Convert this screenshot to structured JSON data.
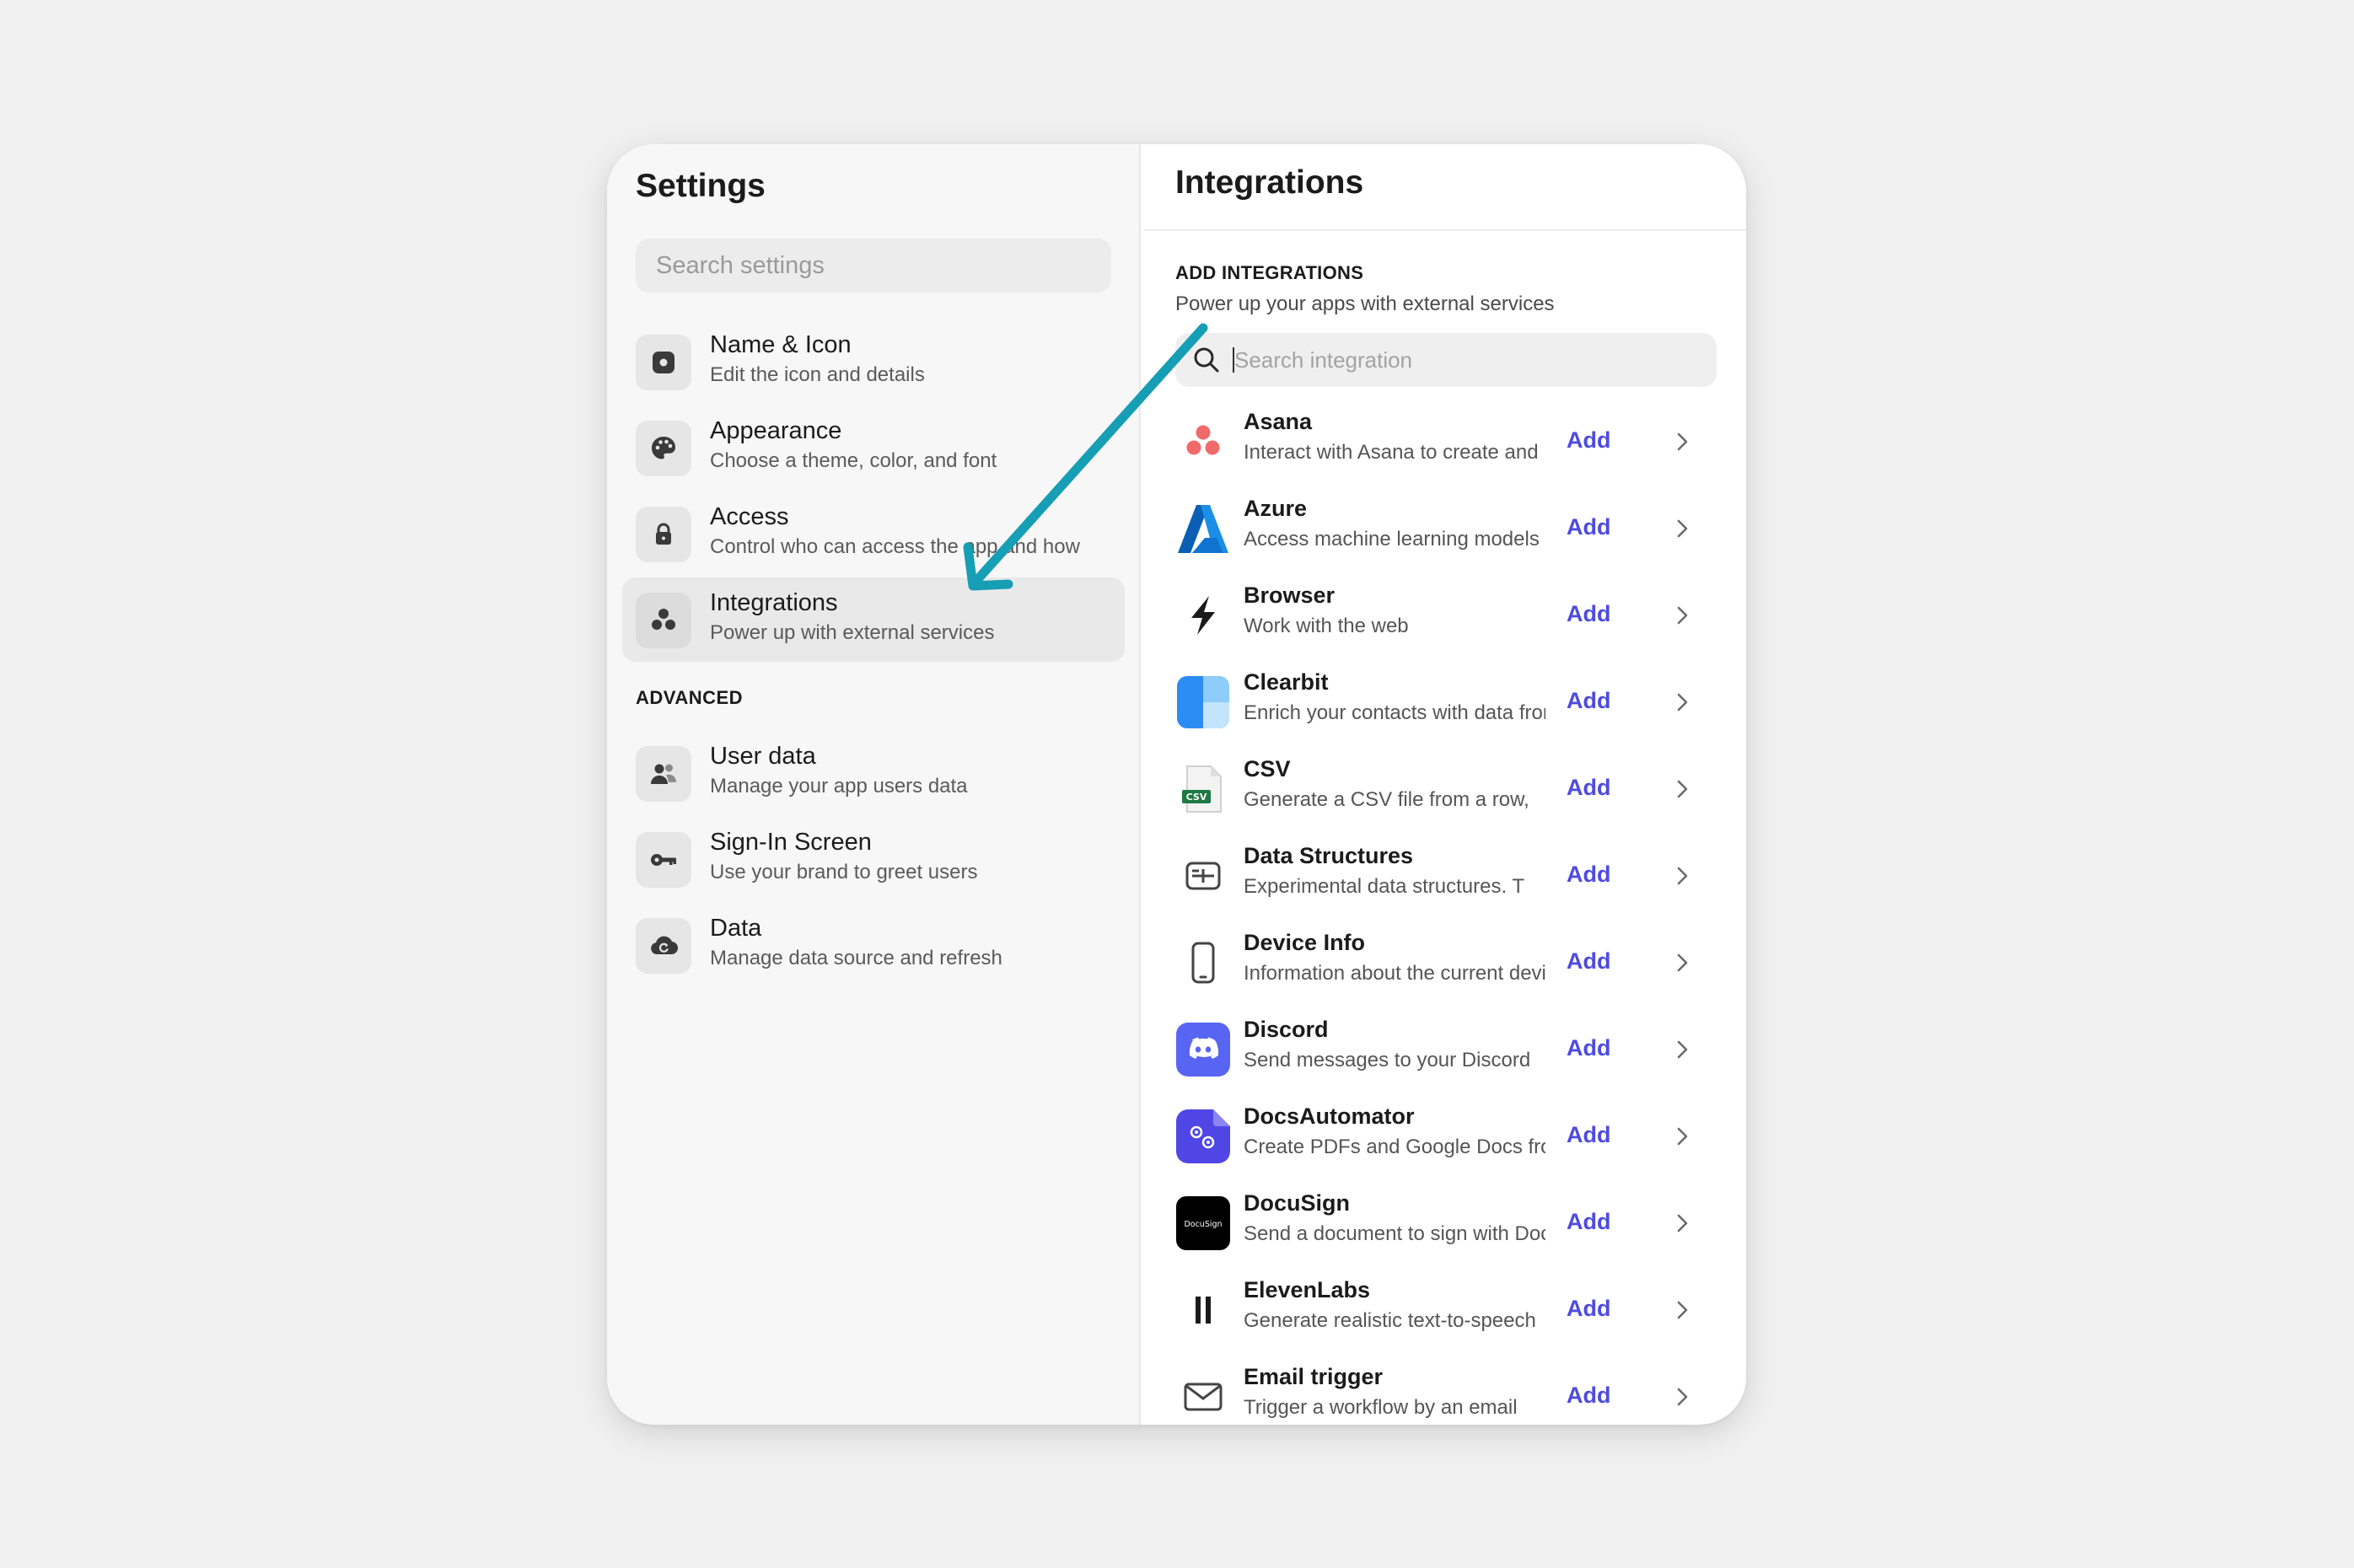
{
  "sidebar": {
    "title": "Settings",
    "search_placeholder": "Search settings",
    "items": [
      {
        "label": "Name & Icon",
        "desc": "Edit the icon and details",
        "icon": "app-icon"
      },
      {
        "label": "Appearance",
        "desc": "Choose a theme, color, and font",
        "icon": "palette-icon"
      },
      {
        "label": "Access",
        "desc": "Control who can access the app and how",
        "icon": "lock-icon"
      },
      {
        "label": "Integrations",
        "desc": "Power up with external services",
        "icon": "integrations-icon",
        "selected": true
      }
    ],
    "advanced_heading": "ADVANCED",
    "advanced_items": [
      {
        "label": "User data",
        "desc": "Manage your app users data",
        "icon": "users-icon"
      },
      {
        "label": "Sign-In Screen",
        "desc": "Use your brand to greet users",
        "icon": "key-icon"
      },
      {
        "label": "Data",
        "desc": "Manage data source and refresh",
        "icon": "cloud-sync-icon"
      }
    ]
  },
  "panel": {
    "title": "Integrations",
    "heading": "ADD INTEGRATIONS",
    "subheading": "Power up your apps with external services",
    "search_placeholder": "Search integration",
    "add_label": "Add",
    "integrations": [
      {
        "name": "Asana",
        "desc": "Interact with Asana to create and",
        "icon": "asana-icon"
      },
      {
        "name": "Azure",
        "desc": "Access machine learning models",
        "icon": "azure-icon"
      },
      {
        "name": "Browser",
        "desc": "Work with the web",
        "icon": "browser-icon"
      },
      {
        "name": "Clearbit",
        "desc": "Enrich your contacts with data from",
        "icon": "clearbit-icon"
      },
      {
        "name": "CSV",
        "desc": "Generate a CSV file from a row,",
        "icon": "csv-icon",
        "badge": "CSV"
      },
      {
        "name": "Data Structures",
        "desc": "Experimental data structures. T",
        "icon": "data-structures-icon"
      },
      {
        "name": "Device Info",
        "desc": "Information about the current device",
        "icon": "device-icon"
      },
      {
        "name": "Discord",
        "desc": "Send messages to your Discord",
        "icon": "discord-icon"
      },
      {
        "name": "DocsAutomator",
        "desc": "Create PDFs and Google Docs from",
        "icon": "docsautomator-icon"
      },
      {
        "name": "DocuSign",
        "desc": "Send a document to sign with DocuSign",
        "icon": "docusign-icon",
        "badge": "DocuSign"
      },
      {
        "name": "ElevenLabs",
        "desc": "Generate realistic text-to-speech",
        "icon": "elevenlabs-icon"
      },
      {
        "name": "Email trigger",
        "desc": "Trigger a workflow by an email",
        "icon": "email-icon"
      }
    ]
  },
  "colors": {
    "accent": "#4e4bdf",
    "annotation_arrow": "#169eb5",
    "asana": "#f06a6a",
    "azure": "#0078d4",
    "clearbit": "#3fa2f7",
    "discord": "#5865f2",
    "docsautomator": "#4f46e5"
  }
}
